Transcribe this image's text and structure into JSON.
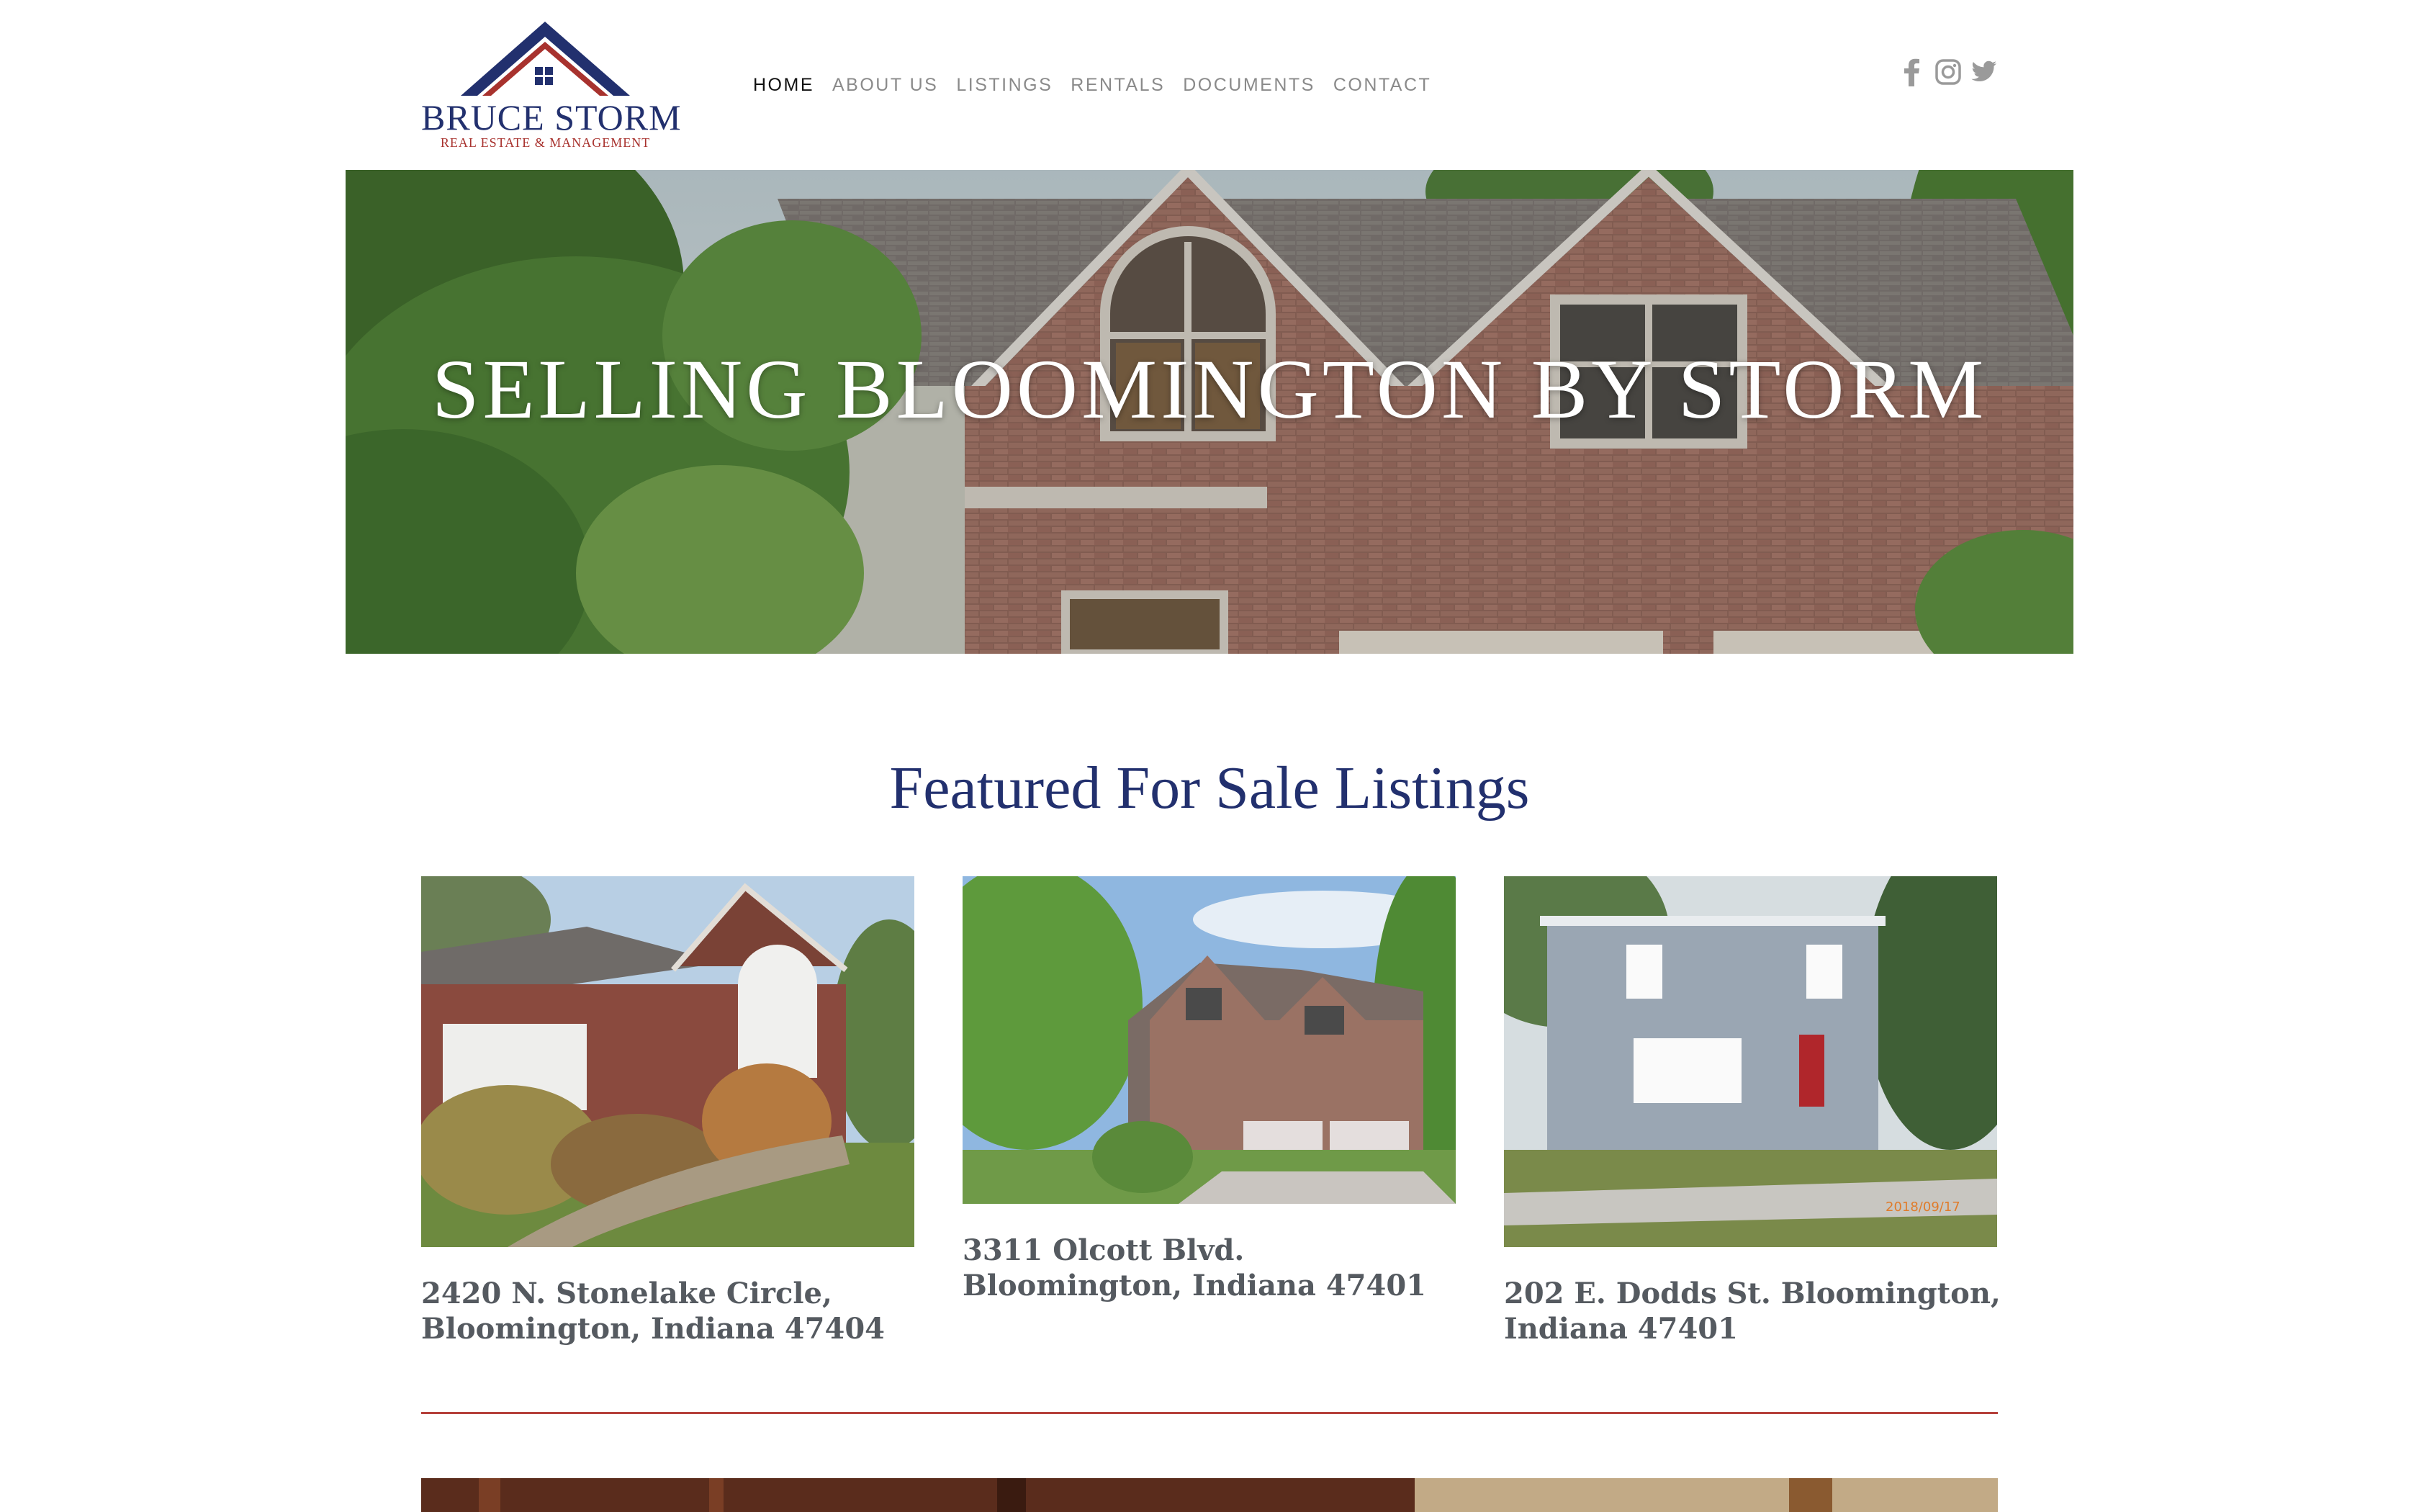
{
  "brand": {
    "name": "BRUCE STORM",
    "tagline": "REAL ESTATE & MANAGEMENT",
    "primary_color": "#22306e",
    "accent_color": "#a8322e"
  },
  "nav": {
    "items": [
      {
        "label": "HOME",
        "active": true
      },
      {
        "label": "ABOUT US",
        "active": false
      },
      {
        "label": "LISTINGS",
        "active": false
      },
      {
        "label": "RENTALS",
        "active": false
      },
      {
        "label": "DOCUMENTS",
        "active": false
      },
      {
        "label": "CONTACT",
        "active": false
      }
    ]
  },
  "social": {
    "icons": [
      "facebook-icon",
      "instagram-icon",
      "twitter-icon"
    ]
  },
  "hero": {
    "title": "SELLING BLOOMINGTON BY STORM"
  },
  "featured": {
    "title": "Featured For Sale Listings",
    "listings": [
      {
        "address": "2420 N. Stonelake Circle, Bloomington, Indiana 47404"
      },
      {
        "address": "3311 Olcott Blvd. Bloomington, Indiana 47401"
      },
      {
        "address": "202 E. Dodds St. Bloomington, Indiana 47401",
        "photo_stamp": "2018/09/17"
      }
    ]
  }
}
